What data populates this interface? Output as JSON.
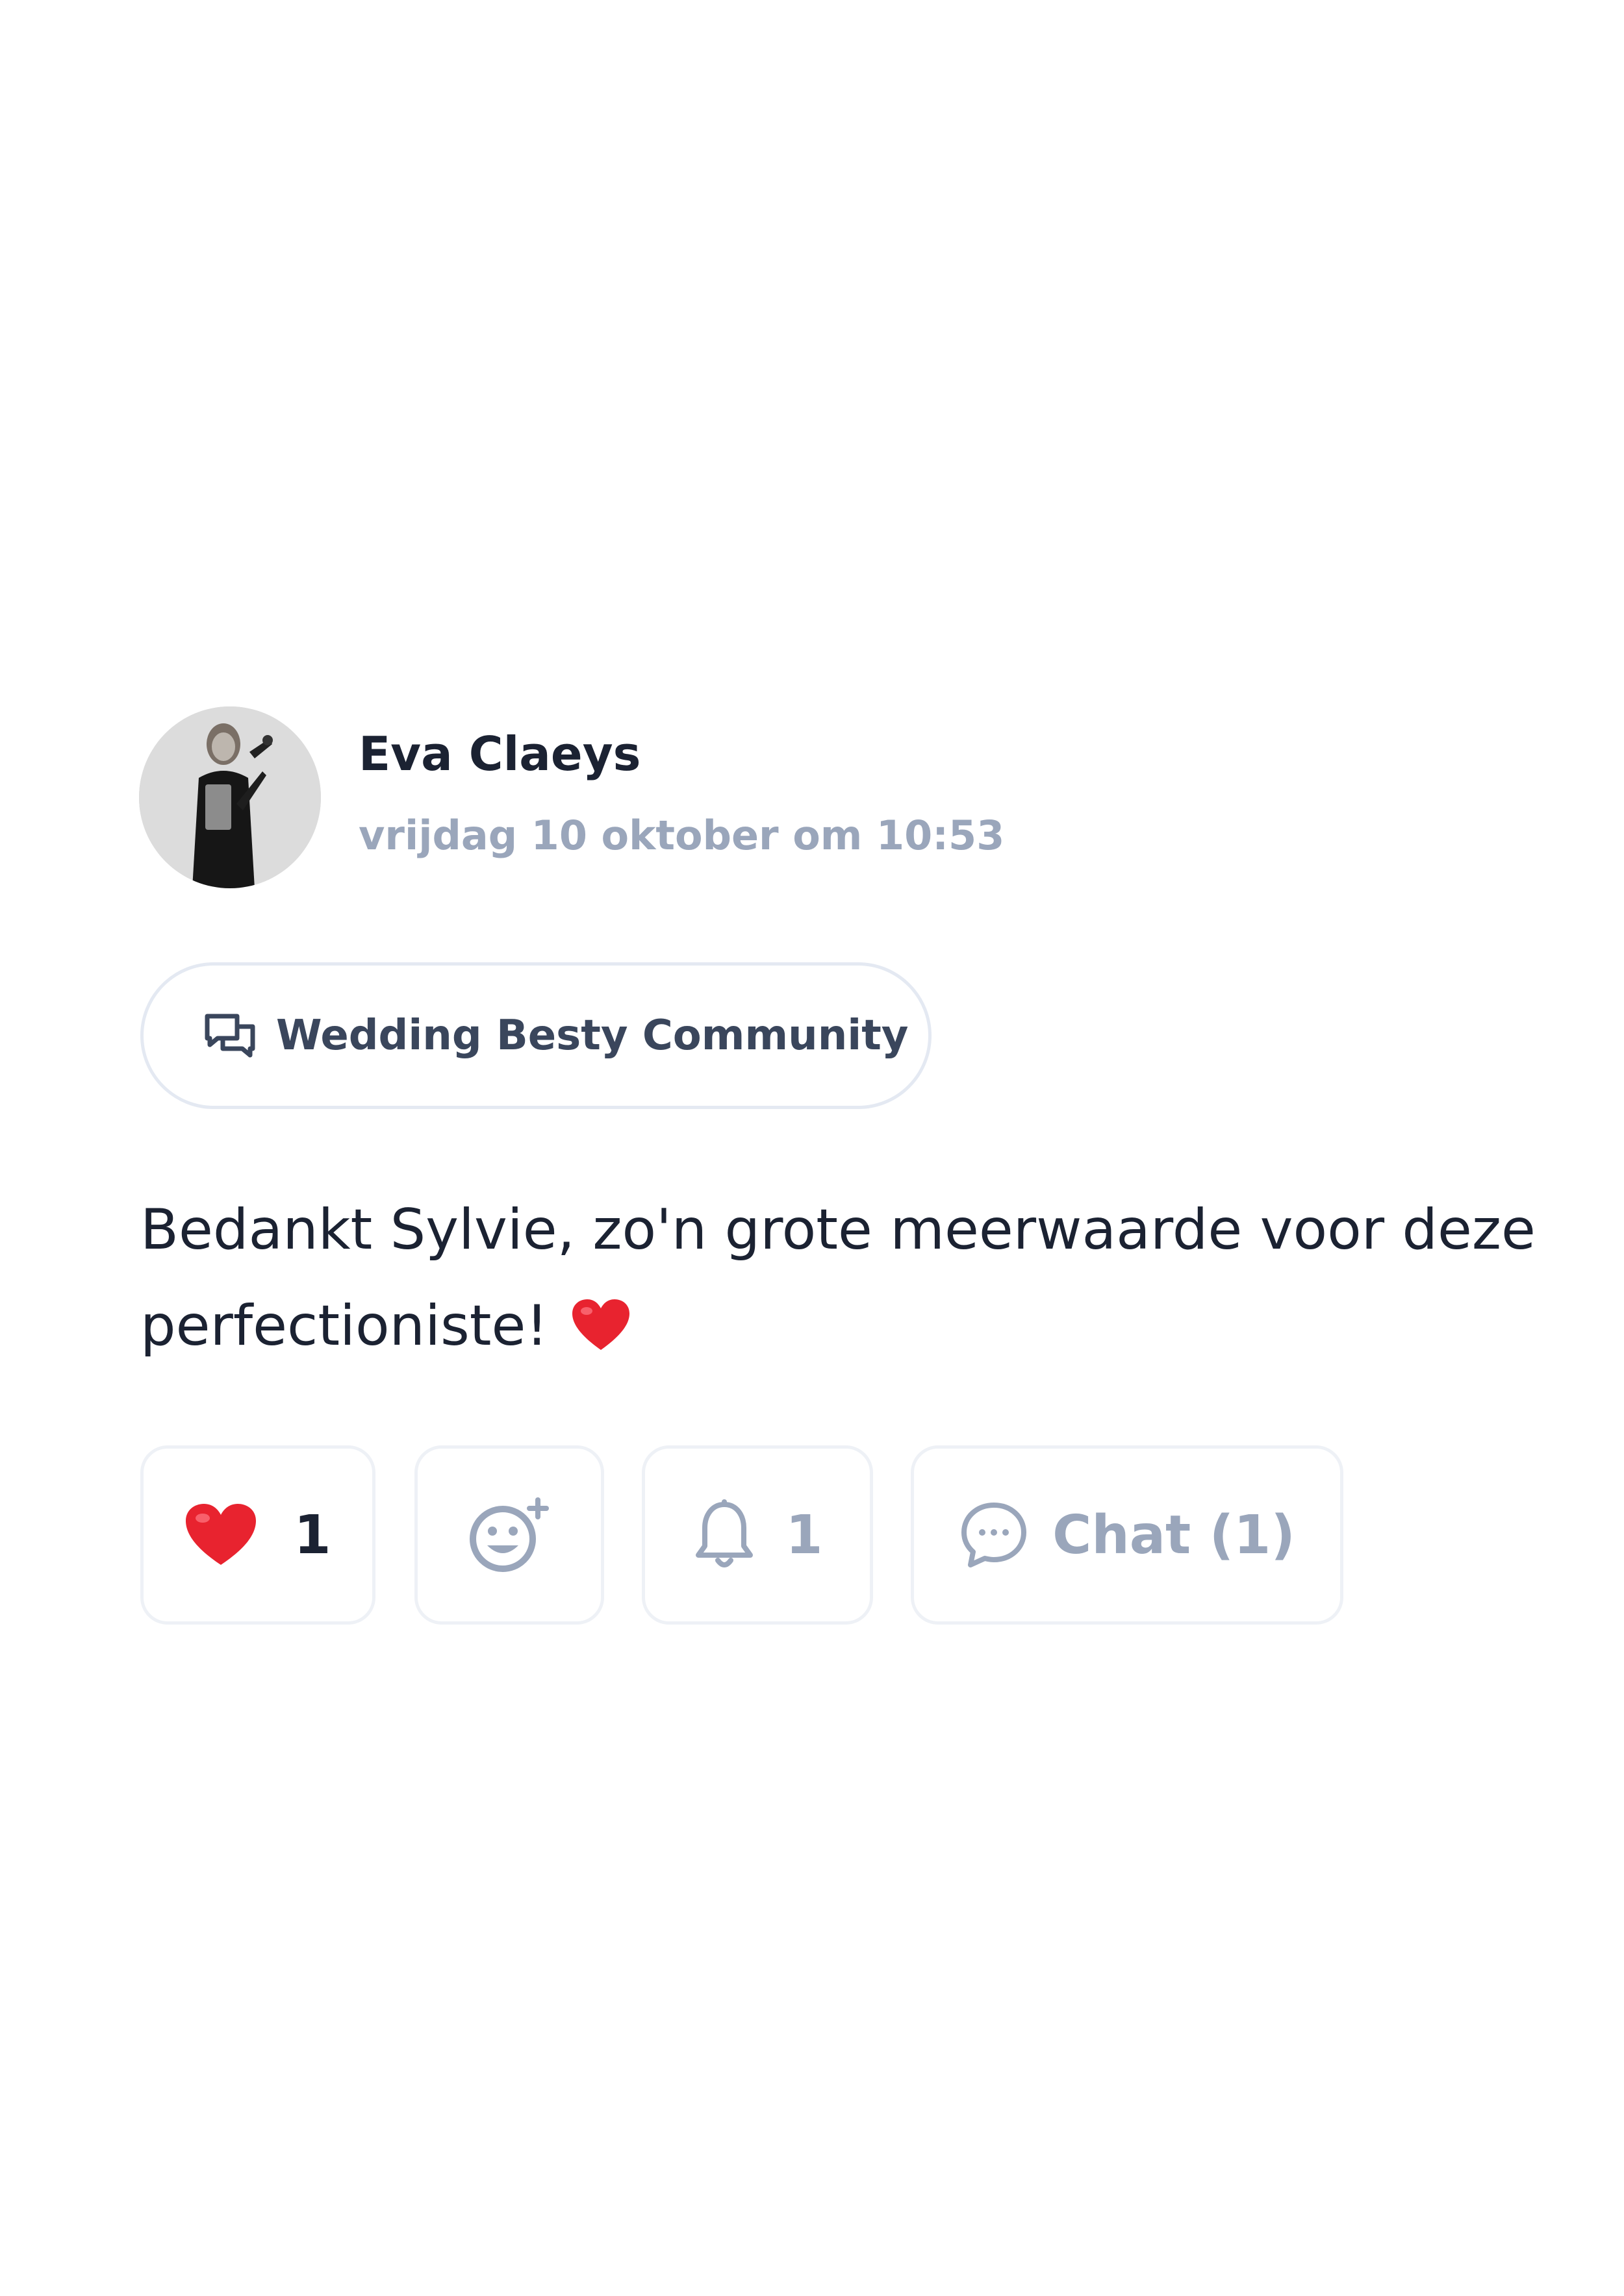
{
  "post": {
    "author": "Eva Claeys",
    "timestamp": "vrijdag 10 oktober om 10:53",
    "community": {
      "label": "Wedding Besty Community",
      "icon": "chat-bubbles-icon"
    },
    "body_text": "Bedankt Sylvie, zo'n grote meerwaarde voor deze perfectioniste!",
    "body_emoji": "red-heart-emoji"
  },
  "actions": {
    "like": {
      "icon": "red-heart-icon",
      "count": "1"
    },
    "react": {
      "icon": "add-emoji-icon"
    },
    "notify": {
      "icon": "bell-icon",
      "count": "1"
    },
    "chat": {
      "icon": "chat-bubble-icon",
      "label": "Chat (1)"
    }
  },
  "colors": {
    "text_primary": "#1b2232",
    "text_muted": "#9aa6bb",
    "border": "#e4e9f2",
    "heart": "#e8232f"
  }
}
